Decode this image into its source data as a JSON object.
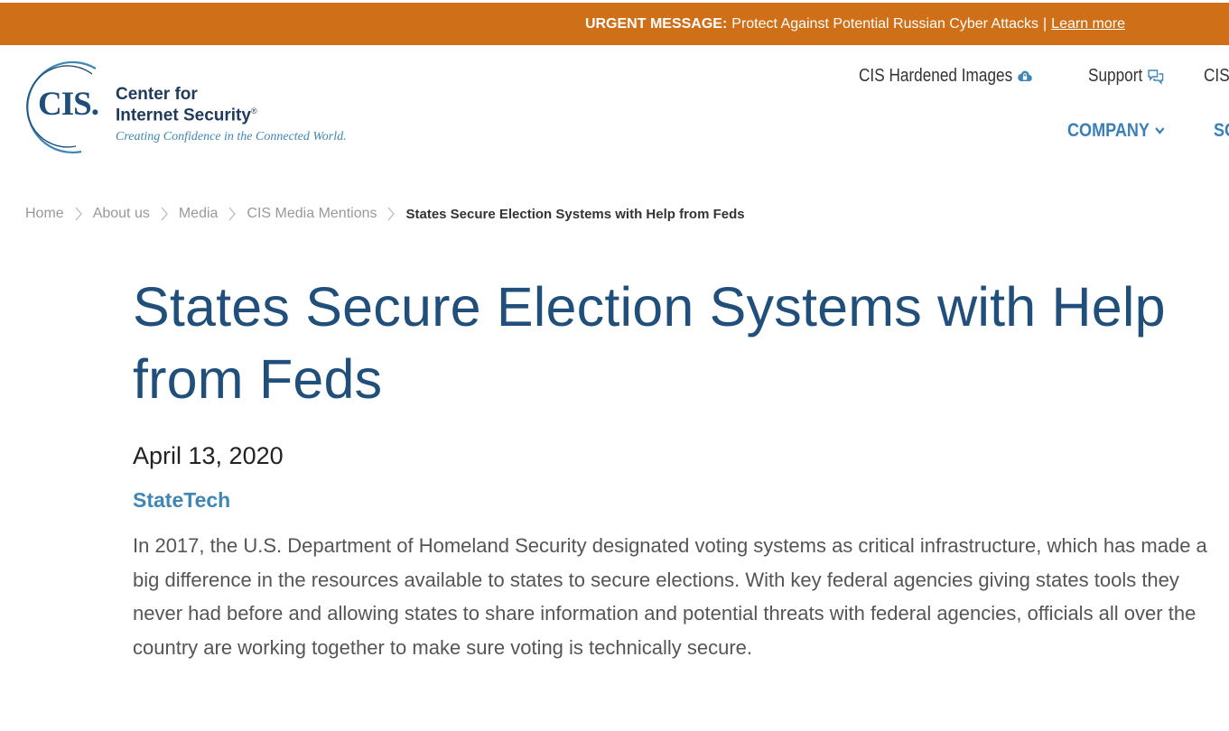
{
  "banner": {
    "label": "URGENT MESSAGE:",
    "message": "Protect Against Potential Russian Cyber Attacks",
    "separator": "|",
    "link": "Learn more"
  },
  "logo": {
    "mark": "CIS.",
    "name_line1": "Center for",
    "name_line2": "Internet Security",
    "registered": "®",
    "tagline": "Creating Confidence in the Connected World."
  },
  "utility_nav": [
    {
      "label": "CIS Hardened Images",
      "icon": "cloud-lock-icon"
    },
    {
      "label": "Support",
      "icon": "chat-bubbles-icon"
    },
    {
      "label": "CIS WorkB",
      "icon": ""
    }
  ],
  "main_nav": [
    {
      "label": "COMPANY",
      "icon": "chevron-down-icon"
    },
    {
      "label": "SOL",
      "icon": ""
    }
  ],
  "breadcrumb": {
    "items": [
      "Home",
      "About us",
      "Media",
      "CIS Media Mentions"
    ],
    "current": "States Secure Election Systems with Help from Feds"
  },
  "article": {
    "title": "States Secure Election Systems with Help from Feds",
    "date": "April 13, 2020",
    "source": "StateTech",
    "body": "In 2017, the U.S. Department of Homeland Security designated voting systems as critical infrastructure, which has made a big difference in the resources available to states to secure elections. With key federal agencies giving states tools they never had before and allowing states to share information and potential threats with federal agencies, officials all over the country are working together to make sure voting is technically secure."
  },
  "colors": {
    "banner": "#cf7018",
    "brand_dark": "#1f4e79",
    "brand_light": "#3f86b5",
    "title": "#1f4f7a"
  }
}
